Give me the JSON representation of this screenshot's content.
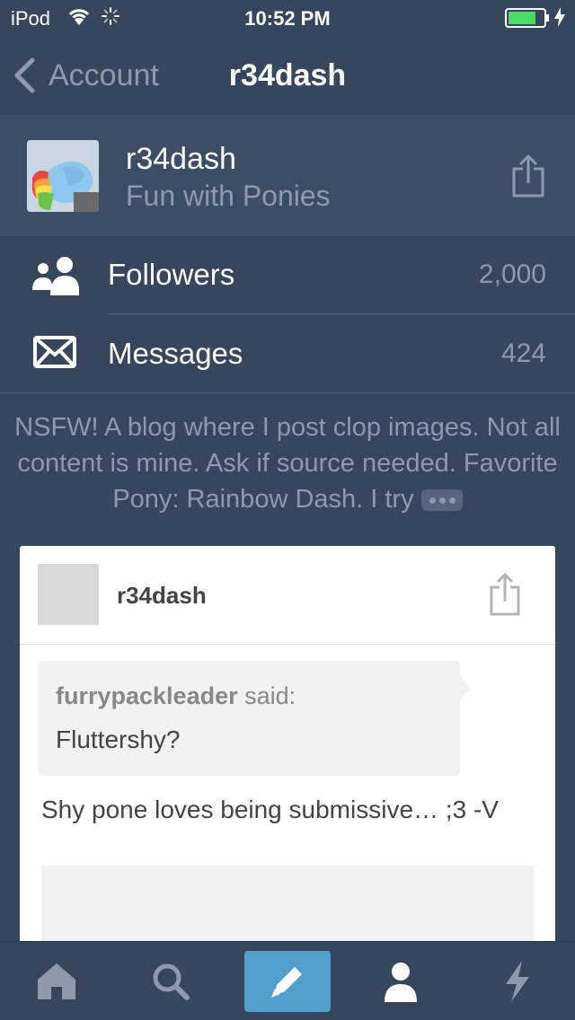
{
  "status_bar": {
    "carrier": "iPod",
    "time": "10:52 PM",
    "battery_color": "#4cd964"
  },
  "nav": {
    "back_label": "Account",
    "title": "r34dash"
  },
  "profile": {
    "name": "r34dash",
    "description": "Fun with Ponies"
  },
  "menu": {
    "followers_label": "Followers",
    "followers_count": "2,000",
    "messages_label": "Messages",
    "messages_count": "424"
  },
  "bio": "NSFW! A blog where I post clop images. Not all content is mine. Ask if source needed. Favorite Pony: Rainbow Dash. I try",
  "post": {
    "blog_name": "r34dash",
    "asker": "furrypackleader",
    "said": "said:",
    "question": "Fluttershy?",
    "answer": "Shy pone loves being submissive… ;3 -V"
  },
  "tabs": {
    "icons": [
      "home-icon",
      "search-icon",
      "compose-icon",
      "account-icon",
      "activity-icon"
    ]
  },
  "colors": {
    "background": "#36465d",
    "accent": "#529ecc",
    "muted_text": "#8e9aab"
  }
}
